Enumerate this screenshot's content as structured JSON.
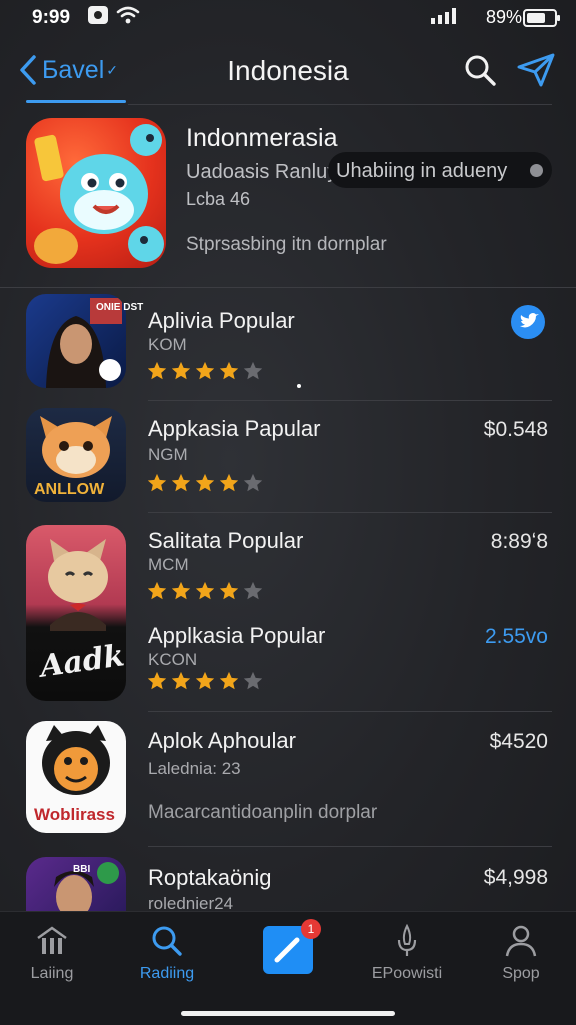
{
  "status_bar": {
    "time": "9:99",
    "battery_pct": "89%"
  },
  "nav": {
    "back_label": "Бavel",
    "title": "Indonesia"
  },
  "featured": {
    "title": "Indonmerasia",
    "subtitle": "Uadoasis Ranluy",
    "pill_label": "Uhabiing in adueny",
    "meta": "Lcba 46",
    "description": "Stprsasbing itn dornplar"
  },
  "apps": [
    {
      "name": "Aplivia Popular",
      "category": "KOM",
      "rating": 4,
      "price": "",
      "icon_text": "ONIE DST"
    },
    {
      "name": "Appkasia Papular",
      "category": "NGM",
      "rating": 4,
      "price": "$0.548",
      "icon_text": "ANLLOW"
    },
    {
      "name": "Salitata Popular",
      "category": "MCM",
      "rating": 4,
      "price": "8:89ʻ8",
      "icon_text": ""
    },
    {
      "name": "Applkasia Popular",
      "category": "KCON",
      "rating": 4,
      "price": "2.55vo",
      "icon_text": "Aadk"
    },
    {
      "name": "Aplok Aphoular",
      "category": "Lalednia: 23",
      "rating": 0,
      "price": "$4520",
      "icon_text": "Woblirass",
      "description": "Macarcantidoanplin dorplar"
    },
    {
      "name": "Roptakaönig",
      "category": "rolednier24",
      "rating": 0,
      "price": "$4,998",
      "icon_text": "BBI"
    }
  ],
  "tabs": [
    {
      "label": "Laiing",
      "icon": "library-icon",
      "active": false
    },
    {
      "label": "Radiing",
      "icon": "search-icon",
      "active": true
    },
    {
      "label": "",
      "icon": "compose-icon",
      "badge": "1",
      "active": false
    },
    {
      "label": "EPoowisti",
      "icon": "microphone-icon",
      "active": false
    },
    {
      "label": "Spop",
      "icon": "person-icon",
      "active": false
    }
  ],
  "colors": {
    "accent": "#3d9bf0",
    "star": "#f2a51a",
    "star_empty": "#6a6b70",
    "background": "#232428"
  }
}
